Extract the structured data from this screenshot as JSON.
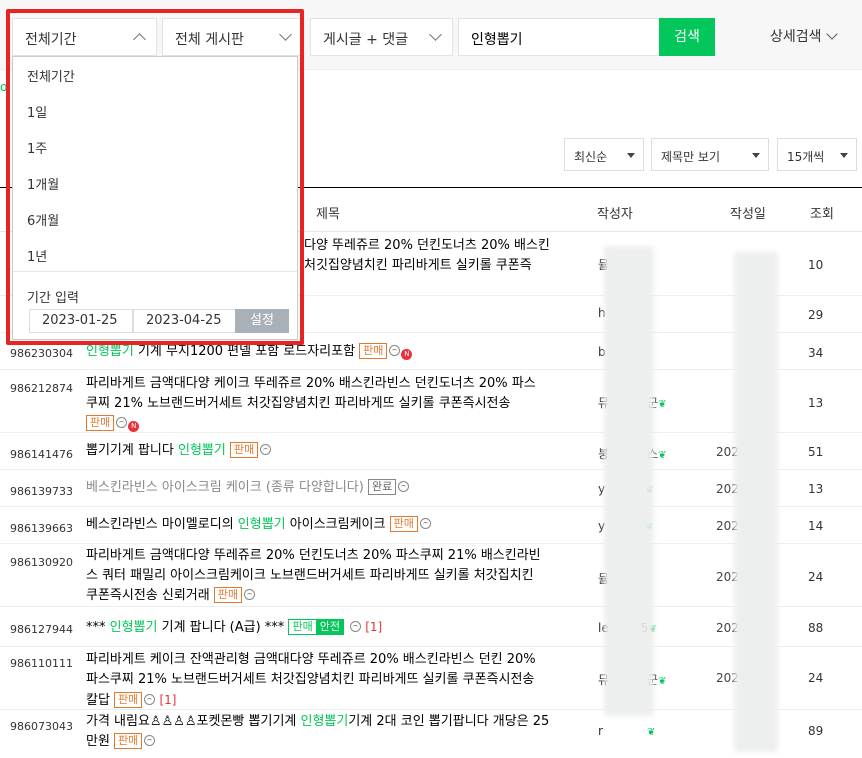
{
  "search": {
    "period": "전체기간",
    "board": "전체 게시판",
    "scope": "게시글 + 댓글",
    "query": "인형뽑기",
    "search_button": "검색",
    "detail_search": "상세검색"
  },
  "sort": {
    "order": "최신순",
    "view": "제목만 보기",
    "per_page": "15개씩"
  },
  "table": {
    "headers": {
      "title": "제목",
      "author": "작성자",
      "date": "작성일",
      "views": "조회"
    }
  },
  "period_dropdown": {
    "options": [
      "전체기간",
      "1일",
      "1주",
      "1개월",
      "6개월",
      "1년"
    ],
    "range_label": "기간 입력",
    "start_date": "2023-01-25",
    "end_date": "2023-04-25",
    "set_button": "설정"
  },
  "peeks": {
    "left_fragment": "o",
    "row1_title_line1": "다양 뚜레쥬르 20% 던킨도너츠 20% 배스킨",
    "row1_title_line2": "처깃집양념치킨 파리바게트 실키롤 쿠폰즉",
    "row1_author": "뮬",
    "row1_views": "10",
    "row2_author": "h",
    "row2_views": "29"
  },
  "rows": [
    {
      "num": "986230304",
      "title_line1_pre": "",
      "title_line1_hl": "인형뽑기",
      "title_line1_post": " 기계 무지1200 편넬 포함 로드자리포함",
      "badge": "판매",
      "author": "b",
      "date": "",
      "views": "34"
    },
    {
      "num": "986212874",
      "title_line1": "파리바게트 금액대다양 케이크 뚜레쥬르 20% 배스킨라빈스 던킨도너츠 20% 파스",
      "title_line2": "쿠찌 21% 노브랜드버거세트 처갓집양념치킨 파리바게뜨 실키롤 쿠폰즉시전송",
      "badge": "판매",
      "author": "뮤",
      "author_tail": "군",
      "date": "",
      "views": "13"
    },
    {
      "num": "986141476",
      "title_pre": "뽑기기계 팝니다 ",
      "title_hl": "인형뽑기",
      "badge": "판매",
      "author": "붕",
      "author_tail": "스",
      "date": "202",
      "views": "51"
    },
    {
      "num": "986139733",
      "title": "베스킨라빈스 아이스크림 케이크 (종류 다양합니다)",
      "badge": "완료",
      "author": "y",
      "date": "202",
      "views": "13"
    },
    {
      "num": "986139663",
      "title_pre": "베스킨라빈스 마이멜로디의 ",
      "title_hl": "인형뽑기",
      "title_post": " 아이스크림케이크",
      "badge": "판매",
      "author": "y",
      "date": "202",
      "views": "14"
    },
    {
      "num": "986130920",
      "title_line1": "파리바게트 금액대다양 뚜레쥬르 20% 던킨도너츠 20% 파스쿠찌 21% 배스킨라빈",
      "title_line2": "스 쿼터 패밀리 아이스크림케이크 노브랜드버거세트 파리바게뜨 실키롤 처갓집치킨",
      "title_line3": "쿠폰즉시전송 신뢰거래",
      "badge": "판매",
      "author": "뮬",
      "date": "202",
      "views": "24"
    },
    {
      "num": "986127944",
      "title_pre": "*** ",
      "title_hl": "인형뽑기",
      "title_post": " 기계 팝니다 (A급) ***",
      "badge": "판매",
      "badge2": "안전",
      "comments": "[1]",
      "author": "le",
      "author_tail": "5",
      "date": "202",
      "views": "88"
    },
    {
      "num": "986110111",
      "title_line1": "파리바게트 케이크 잔액관리형 금액대다양 뚜레쥬르 20% 배스킨라빈스 던킨 20%",
      "title_line2": "파스쿠찌 21% 노브랜드버거세트 처갓집양념치킨 파리바게뜨 실키롤 쿠폰즉시전송",
      "title_line3": "칼답",
      "badge": "판매",
      "comments": "[1]",
      "author": "뮤",
      "author_tail": "군",
      "date": "202",
      "views": "24"
    },
    {
      "num": "986073043",
      "title_line1_pre": "가격 내림요♙♙♙♙포켓몬빵 뽑기기계 ",
      "title_line1_hl": "인형뽑기",
      "title_line1_post": "기계 2대 코인 뽑기팝니다 개당은 25",
      "title_line2": "만원",
      "badge": "판매",
      "author": "r",
      "date": "",
      "views": "89"
    }
  ]
}
